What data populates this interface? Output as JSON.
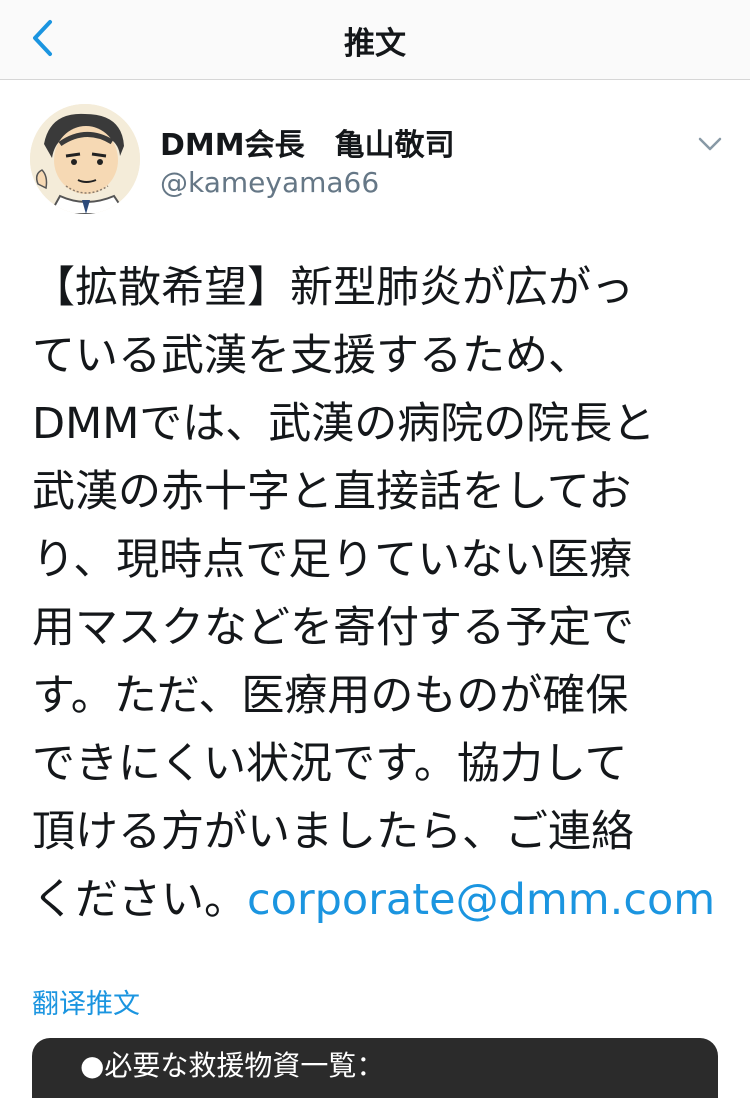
{
  "nav": {
    "title": "推文",
    "back_icon": "chevron-left-icon"
  },
  "tweet": {
    "author": {
      "display_name": "DMM会長　亀山敬司",
      "handle": "@kameyama66"
    },
    "caret_icon": "chevron-down-icon",
    "text_lines": [
      "【拡散希望】新型肺炎が広がっ",
      "ている武漢を支援するため、",
      "DMMでは、武漢の病院の院長と",
      "武漢の赤十字と直接話をしてお",
      "り、現時点で足りていない医療",
      "用マスクなどを寄付する予定で",
      "す。ただ、医療用のものが確保",
      "できにくい状況です。協力して",
      "頂ける方がいましたら、ご連絡",
      "ください。"
    ],
    "link": "corporate@dmm.com",
    "translate_label": "翻译推文",
    "media_caption": "●必要な救援物資一覧："
  },
  "colors": {
    "link": "#1b95e0",
    "text": "#14171a",
    "secondary": "#657786",
    "media_bg": "#2b2b2b"
  }
}
